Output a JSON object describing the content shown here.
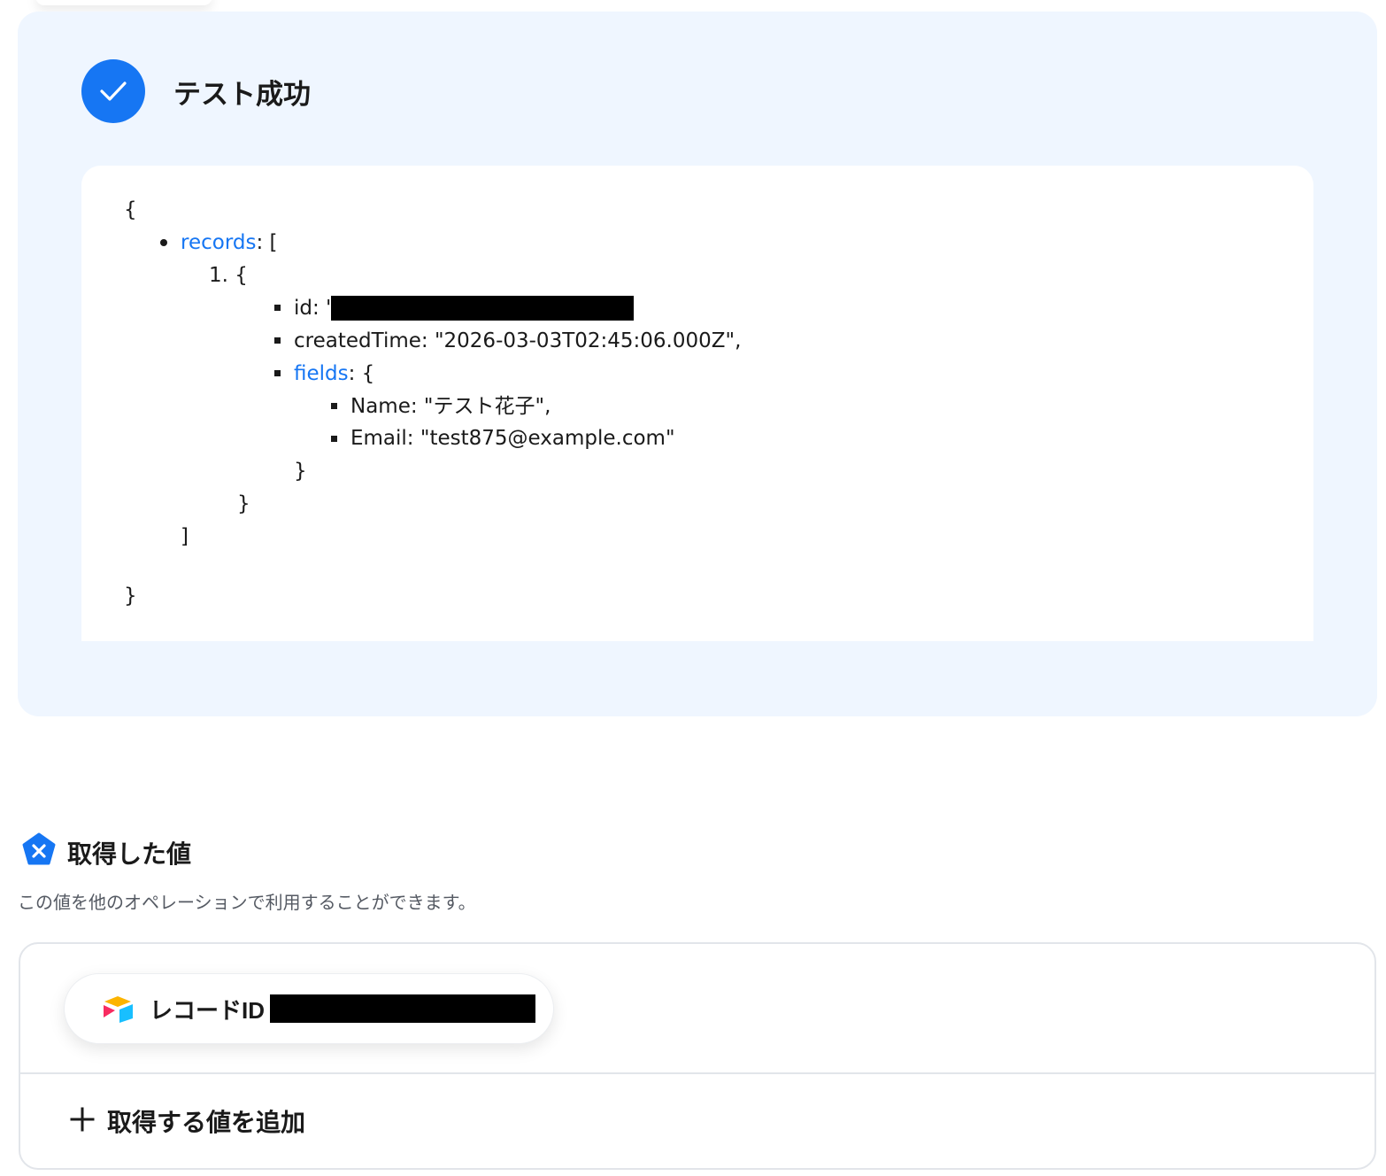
{
  "test_result": {
    "title": "テスト成功",
    "icon": "check-icon",
    "accent_color": "#1676f3",
    "background_color": "#eff6ff"
  },
  "code": {
    "open_brace": "{",
    "records_key": "records",
    "records_suffix": ": [",
    "item_index": "1.",
    "item_open": "{",
    "id_prefix": "id: \"",
    "created_time_line": "createdTime: \"2026-03-03T02:45:06.000Z\",",
    "fields_key": "fields",
    "fields_suffix": ": {",
    "name_line": "Name: \"テスト花子\",",
    "email_line": "Email: \"test875@example.com\"",
    "fields_close": "}",
    "item_close": "}",
    "records_close": "]",
    "close_brace": "}",
    "key_color": "#1676f3"
  },
  "values_section": {
    "title": "取得した値",
    "icon": "variable-x-icon",
    "description": "この値を他のオペレーションで利用することができます。",
    "pill_label": "レコードID",
    "pill_icon": "airtable-icon",
    "add_label": "取得する値を追加",
    "add_icon": "plus-icon"
  }
}
